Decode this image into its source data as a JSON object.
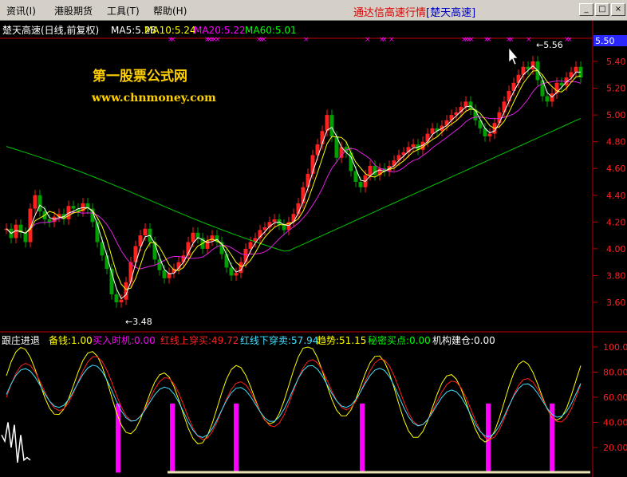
{
  "menubar": {
    "items": [
      "资讯(I)",
      "港股期货",
      "工具(T)",
      "帮助(H)"
    ],
    "title_prefix": "通达信高速行情",
    "title_symbol": "[楚天高速]",
    "win_buttons": [
      "_",
      "□",
      "×"
    ]
  },
  "main_panel": {
    "stock_label": "楚天高速(日线,前复权)",
    "ma": [
      {
        "label": "MA5:5.28",
        "color": "#ffffff"
      },
      {
        "label": "MA10:5.24",
        "color": "#ffff00"
      },
      {
        "label": "MA20:5.22",
        "color": "#ff00ff"
      },
      {
        "label": "MA60:5.01",
        "color": "#00ff00"
      }
    ],
    "current_price": "5.50",
    "watermark_title": "第一股票公式网",
    "watermark_url": "www.chnmoney.com",
    "high_annotation": "←5.56",
    "low_annotation": "←3.48",
    "y_ticks": [
      "5.40",
      "5.20",
      "5.00",
      "4.80",
      "4.60",
      "4.40",
      "4.20",
      "4.00",
      "3.80",
      "3.60"
    ]
  },
  "indicator_panel": {
    "title": "跟庄进退",
    "values": [
      {
        "text": "备钱:1.00",
        "color": "#ffff00"
      },
      {
        "text": "买入时机:0.00",
        "color": "#ff00ff"
      },
      {
        "text": "红线上穿买:49.72",
        "color": "#ff2020"
      },
      {
        "text": "红线下穿卖:57.94",
        "color": "#40e0ff"
      },
      {
        "text": "趋势:51.15",
        "color": "#ffff00"
      },
      {
        "text": "秘密买点:0.00",
        "color": "#00ff00"
      },
      {
        "text": "机构建仓:0.00",
        "color": "#ffffff"
      }
    ],
    "y_ticks": [
      "100.0",
      "80.00",
      "60.00",
      "40.00",
      "20.00"
    ]
  },
  "colors": {
    "axis": "#c00000",
    "up_candle": "#ff2020",
    "down_candle": "#00a000",
    "price_box_bg": "#2828ff",
    "watermark": "#ffd000"
  }
}
